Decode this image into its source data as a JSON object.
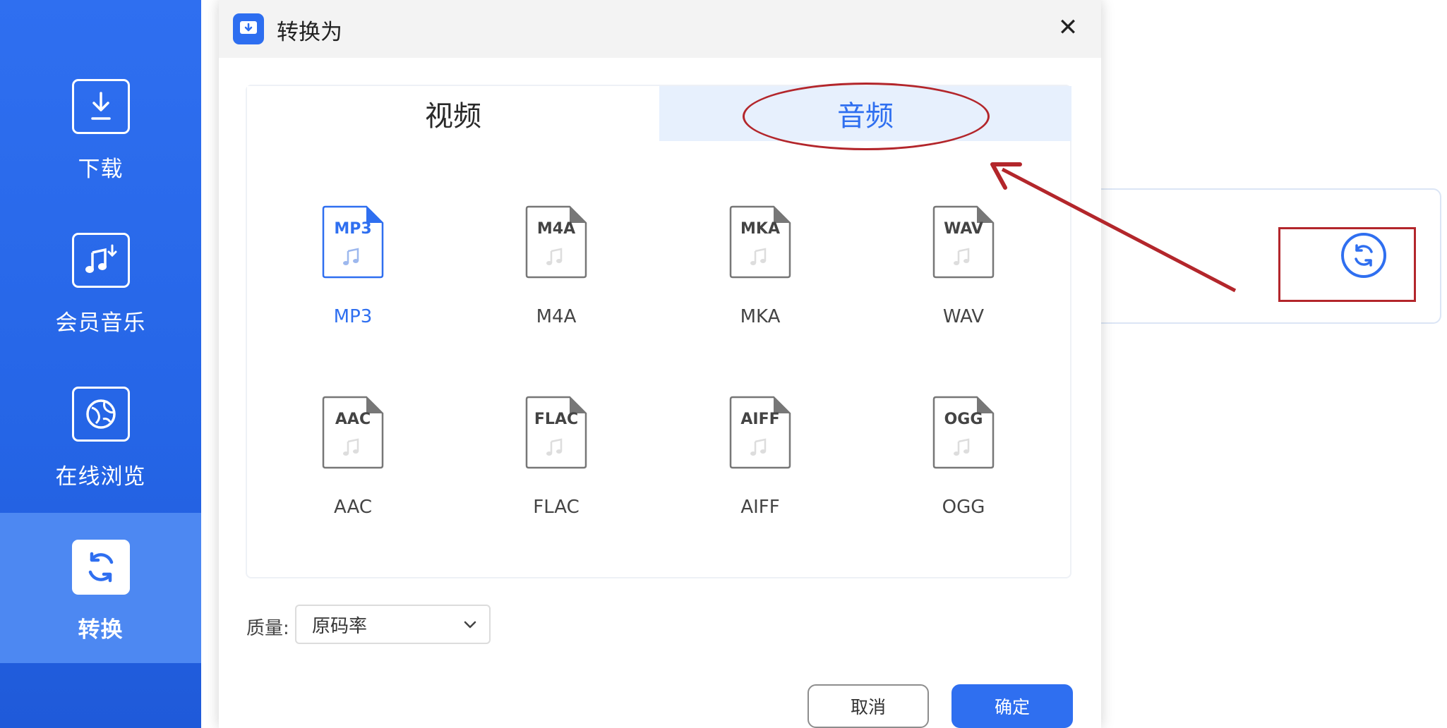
{
  "sidebar": {
    "items": [
      {
        "label": "下载",
        "icon": "download-icon"
      },
      {
        "label": "会员音乐",
        "icon": "music-download-icon"
      },
      {
        "label": "在线浏览",
        "icon": "globe-icon"
      },
      {
        "label": "转换",
        "icon": "convert-icon",
        "active": true
      }
    ]
  },
  "dialog": {
    "title": "转换为",
    "close_label": "✕",
    "tabs": [
      {
        "label": "视频",
        "active": false
      },
      {
        "label": "音频",
        "active": true
      }
    ],
    "formats": [
      {
        "icon_text": "MP3",
        "label": "MP3",
        "selected": true
      },
      {
        "icon_text": "M4A",
        "label": "M4A",
        "selected": false
      },
      {
        "icon_text": "MKA",
        "label": "MKA",
        "selected": false
      },
      {
        "icon_text": "WAV",
        "label": "WAV",
        "selected": false
      },
      {
        "icon_text": "AAC",
        "label": "AAC",
        "selected": false
      },
      {
        "icon_text": "FLAC",
        "label": "FLAC",
        "selected": false
      },
      {
        "icon_text": "AIFF",
        "label": "AIFF",
        "selected": false
      },
      {
        "icon_text": "OGG",
        "label": "OGG",
        "selected": false
      }
    ],
    "quality": {
      "label": "质量:",
      "value": "原码率"
    },
    "cancel_label": "取消",
    "ok_label": "确定"
  },
  "colors": {
    "accent": "#2f6ff0",
    "sidebar": "#2565e6",
    "sidebar_active": "#4d88f2",
    "annotation": "#b3262b",
    "tab_active_bg": "#e7f0fd"
  }
}
